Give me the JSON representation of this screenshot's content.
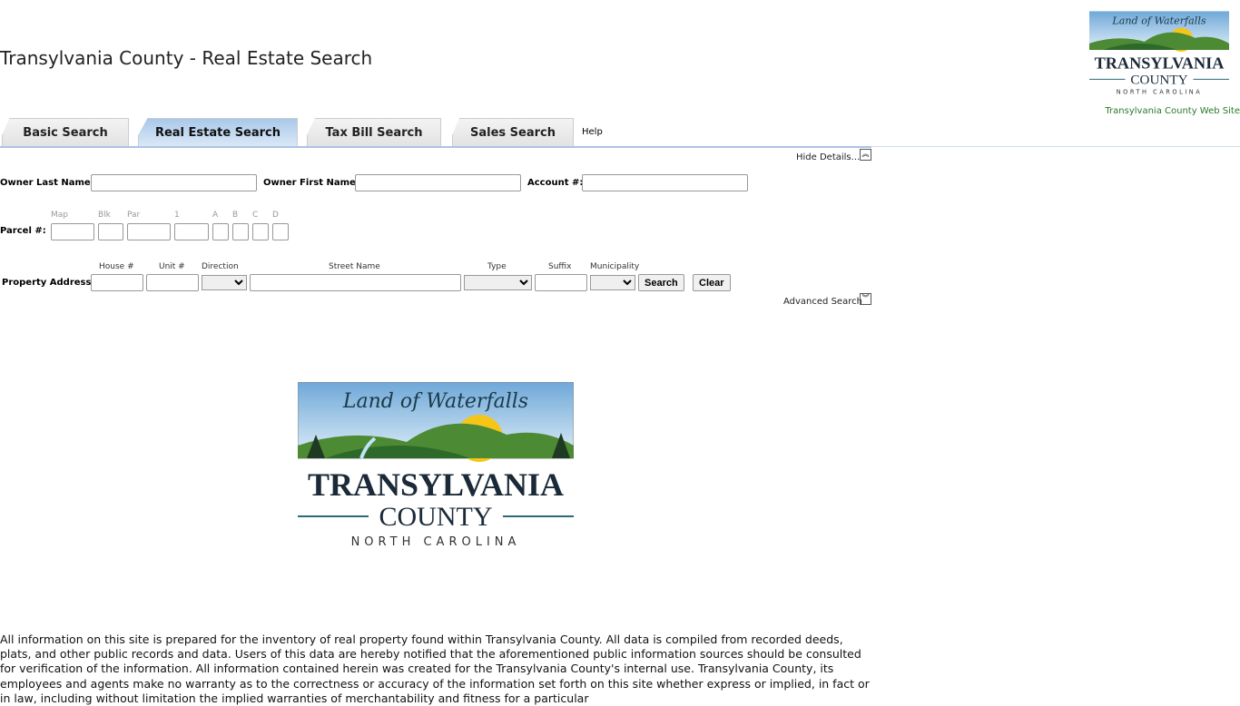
{
  "header": {
    "title": "Transylvania County - Real Estate Search",
    "website_link": "Transylvania County Web Site"
  },
  "logo": {
    "tagline": "Land of Waterfalls",
    "name": "TRANSYLVANIA",
    "county": "COUNTY",
    "state": "NORTH CAROLINA"
  },
  "tabs": [
    {
      "label": "Basic Search",
      "active": false
    },
    {
      "label": "Real Estate Search",
      "active": true
    },
    {
      "label": "Tax Bill Search",
      "active": false
    },
    {
      "label": "Sales Search",
      "active": false
    }
  ],
  "help_label": "Help",
  "hide_details": "Hide Details...",
  "form": {
    "owner_last": "Owner Last Name:",
    "owner_first": "Owner First Name:",
    "account": "Account #:",
    "parcel": "Parcel #:",
    "parcel_parts": [
      "Map",
      "Blk",
      "Par",
      "1",
      "A",
      "B",
      "C",
      "D"
    ],
    "address": "Property Address:",
    "address_parts": [
      "House #",
      "Unit #",
      "Direction",
      "Street Name",
      "Type",
      "Suffix",
      "Municipality"
    ],
    "search": "Search",
    "clear": "Clear"
  },
  "advanced_search": "Advanced Search",
  "disclaimer": "All information on this site is prepared for the inventory of real property found within Transylvania County. All data is compiled from recorded deeds, plats, and other public records and data. Users of this data are hereby notified that the aforementioned public information sources should be consulted for verification of the information. All information contained herein was created for the Transylvania County's internal use. Transylvania County, its employees and agents make no warranty as to the correctness or accuracy of the information set forth on this site whether express or implied, in fact or in law, including without limitation the implied warranties of merchantability and fitness for a particular"
}
